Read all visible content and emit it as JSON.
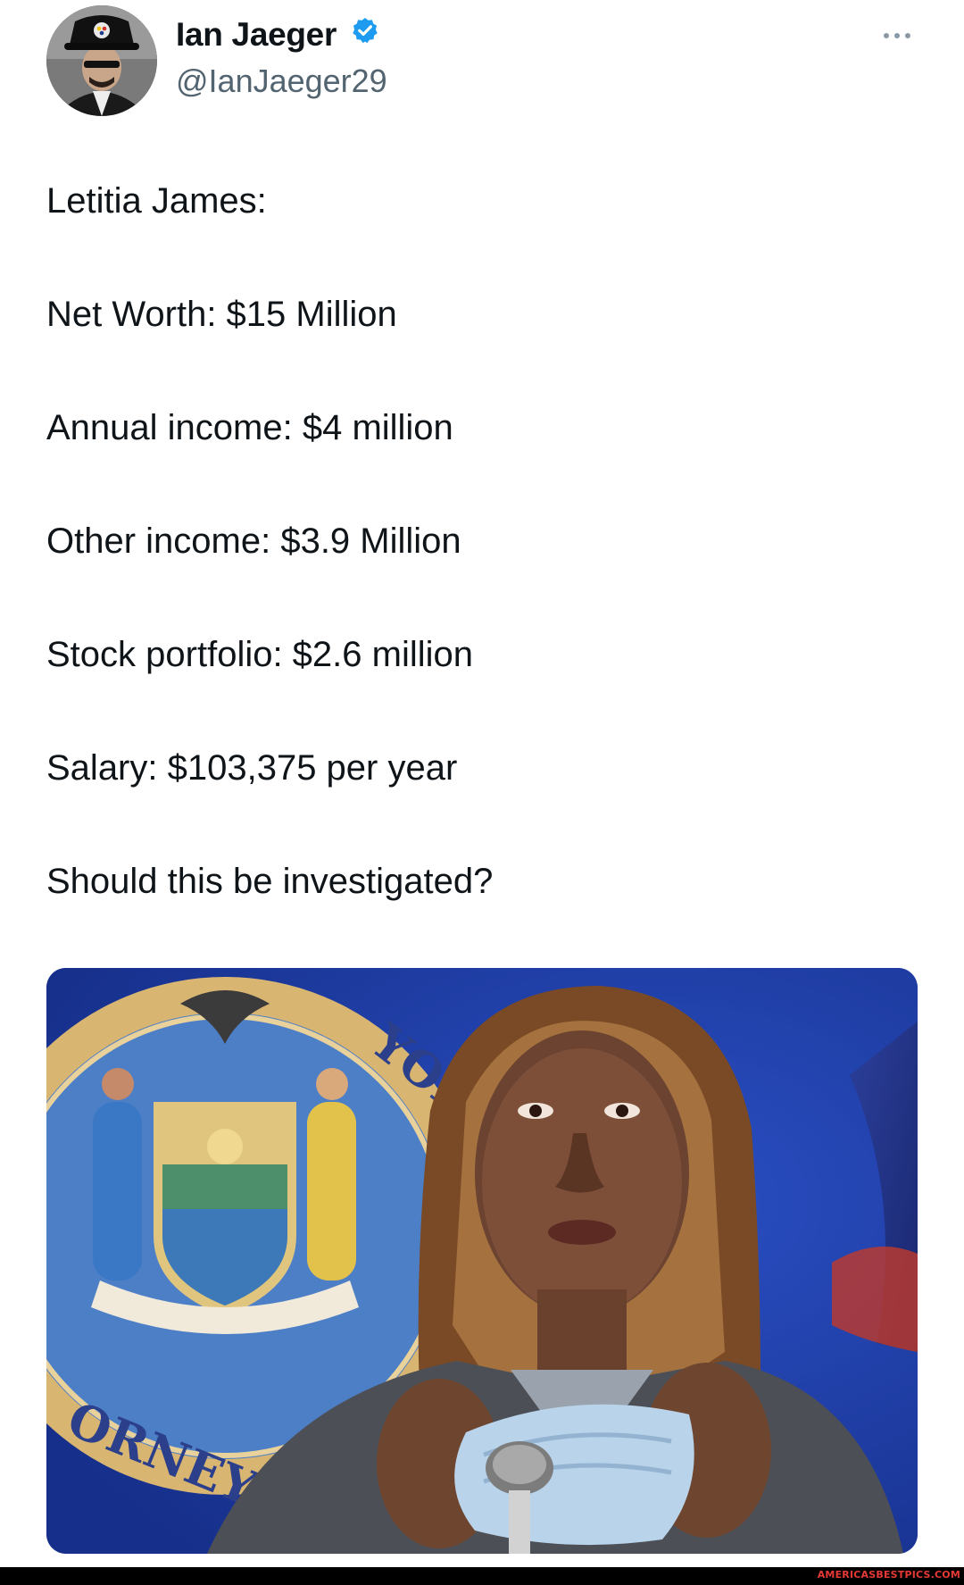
{
  "tweet": {
    "author": {
      "name": "Ian Jaeger",
      "handle": "@IanJaeger29",
      "verified": true,
      "avatar_icon": "avatar-photo"
    },
    "more_icon": "more-options-icon",
    "lines": [
      "Letitia James:",
      "Net Worth: $15 Million",
      "Annual income: $4 million",
      "Other income: $3.9 Million",
      "Stock portfolio: $2.6 million",
      "Salary: $103,375 per year",
      "Should this be investigated?"
    ],
    "media": {
      "seal_text_top": "YORK",
      "seal_text_bottom": "ORNEY"
    }
  },
  "watermark": {
    "text": "AMERICASBESTPICS.COM",
    "color": "#e53935"
  },
  "colors": {
    "verified_badge": "#1d9bf0",
    "handle": "#536471",
    "text": "#0f1419"
  }
}
